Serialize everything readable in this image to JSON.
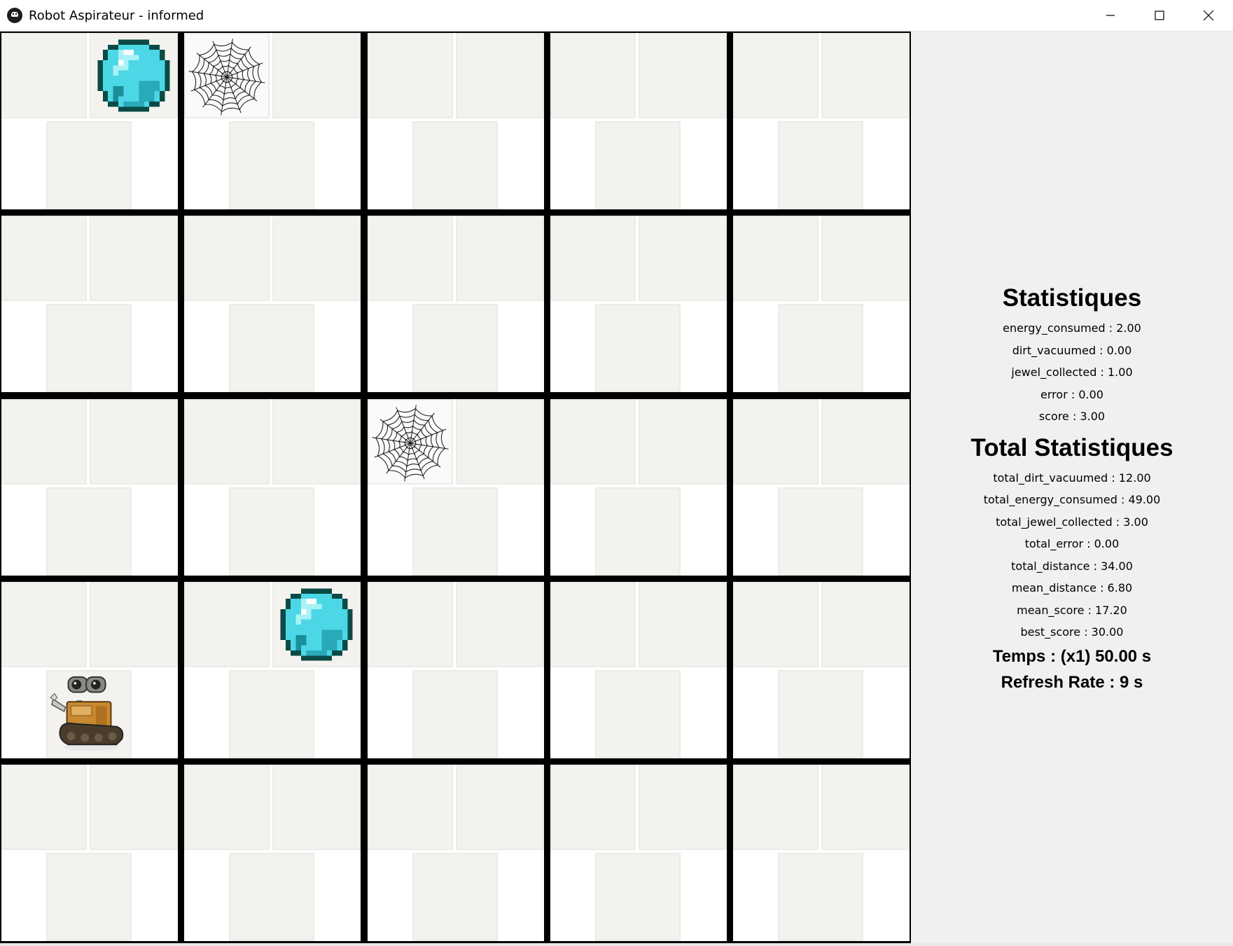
{
  "window": {
    "title": "Robot Aspirateur - informed",
    "controls": [
      "minimize-icon",
      "maximize-icon",
      "close-icon"
    ]
  },
  "grid": {
    "rows": 5,
    "cols": 5,
    "items": [
      {
        "row": 0,
        "col": 0,
        "type": "jewel"
      },
      {
        "row": 0,
        "col": 1,
        "type": "dirt"
      },
      {
        "row": 2,
        "col": 2,
        "type": "dirt"
      },
      {
        "row": 3,
        "col": 1,
        "type": "jewel"
      },
      {
        "row": 3,
        "col": 0,
        "type": "robot"
      }
    ]
  },
  "stats": {
    "title": "Statistiques",
    "lines": [
      "energy_consumed : 2.00",
      "dirt_vacuumed : 0.00",
      "jewel_collected : 1.00",
      "error : 0.00",
      "score : 3.00"
    ]
  },
  "total_stats": {
    "title": "Total Statistiques",
    "lines": [
      "total_dirt_vacuumed : 12.00",
      "total_energy_consumed : 49.00",
      "total_jewel_collected : 3.00",
      "total_error : 0.00",
      "total_distance : 34.00",
      "mean_distance : 6.80",
      "mean_score : 17.20",
      "best_score : 30.00"
    ]
  },
  "time": {
    "temps": "Temps : (x1) 50.00 s",
    "refresh_rate": "Refresh Rate : 9 s"
  }
}
